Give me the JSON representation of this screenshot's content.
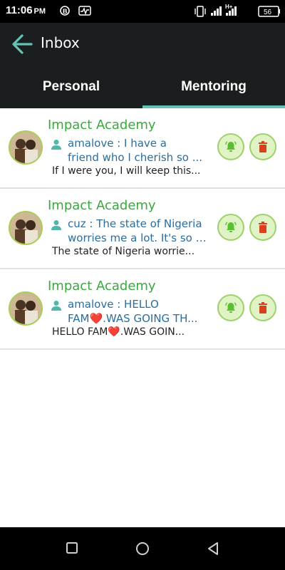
{
  "status_bar": {
    "time": "11:06",
    "ampm": "PM",
    "network_label": "H+",
    "battery": "56"
  },
  "app_bar": {
    "title": "Inbox"
  },
  "tabs": [
    {
      "label": "Personal",
      "selected": false
    },
    {
      "label": "Mentoring",
      "selected": true
    }
  ],
  "messages": [
    {
      "title": "Impact Academy",
      "preview_line1": "amalove : I have a",
      "preview_line2": "friend who I cherish so ...",
      "subtext": "If I were you, I will keep this..."
    },
    {
      "title": "Impact Academy",
      "preview_line1": "cuz : The state of Nigeria",
      "preview_line2": "worries me a lot. It's so p...",
      "subtext": "The state of Nigeria worrie..."
    },
    {
      "title": "Impact Academy",
      "preview_line1": "amalove : HELLO",
      "preview_line2": "FAM❤️.WAS GOING TH...",
      "subtext": "HELLO FAM❤️.WAS GOIN..."
    }
  ],
  "colors": {
    "header_bg": "#1a1e1e",
    "accent_teal": "#64c3b2",
    "title_green": "#3aa83e",
    "preview_blue": "#2b6d9d",
    "button_green": "#5bbf32",
    "trash_red": "#d9411e"
  },
  "icons": [
    "back-arrow-icon",
    "person-icon",
    "bell-icon",
    "trash-icon",
    "recent-apps-icon",
    "home-icon",
    "back-icon"
  ]
}
